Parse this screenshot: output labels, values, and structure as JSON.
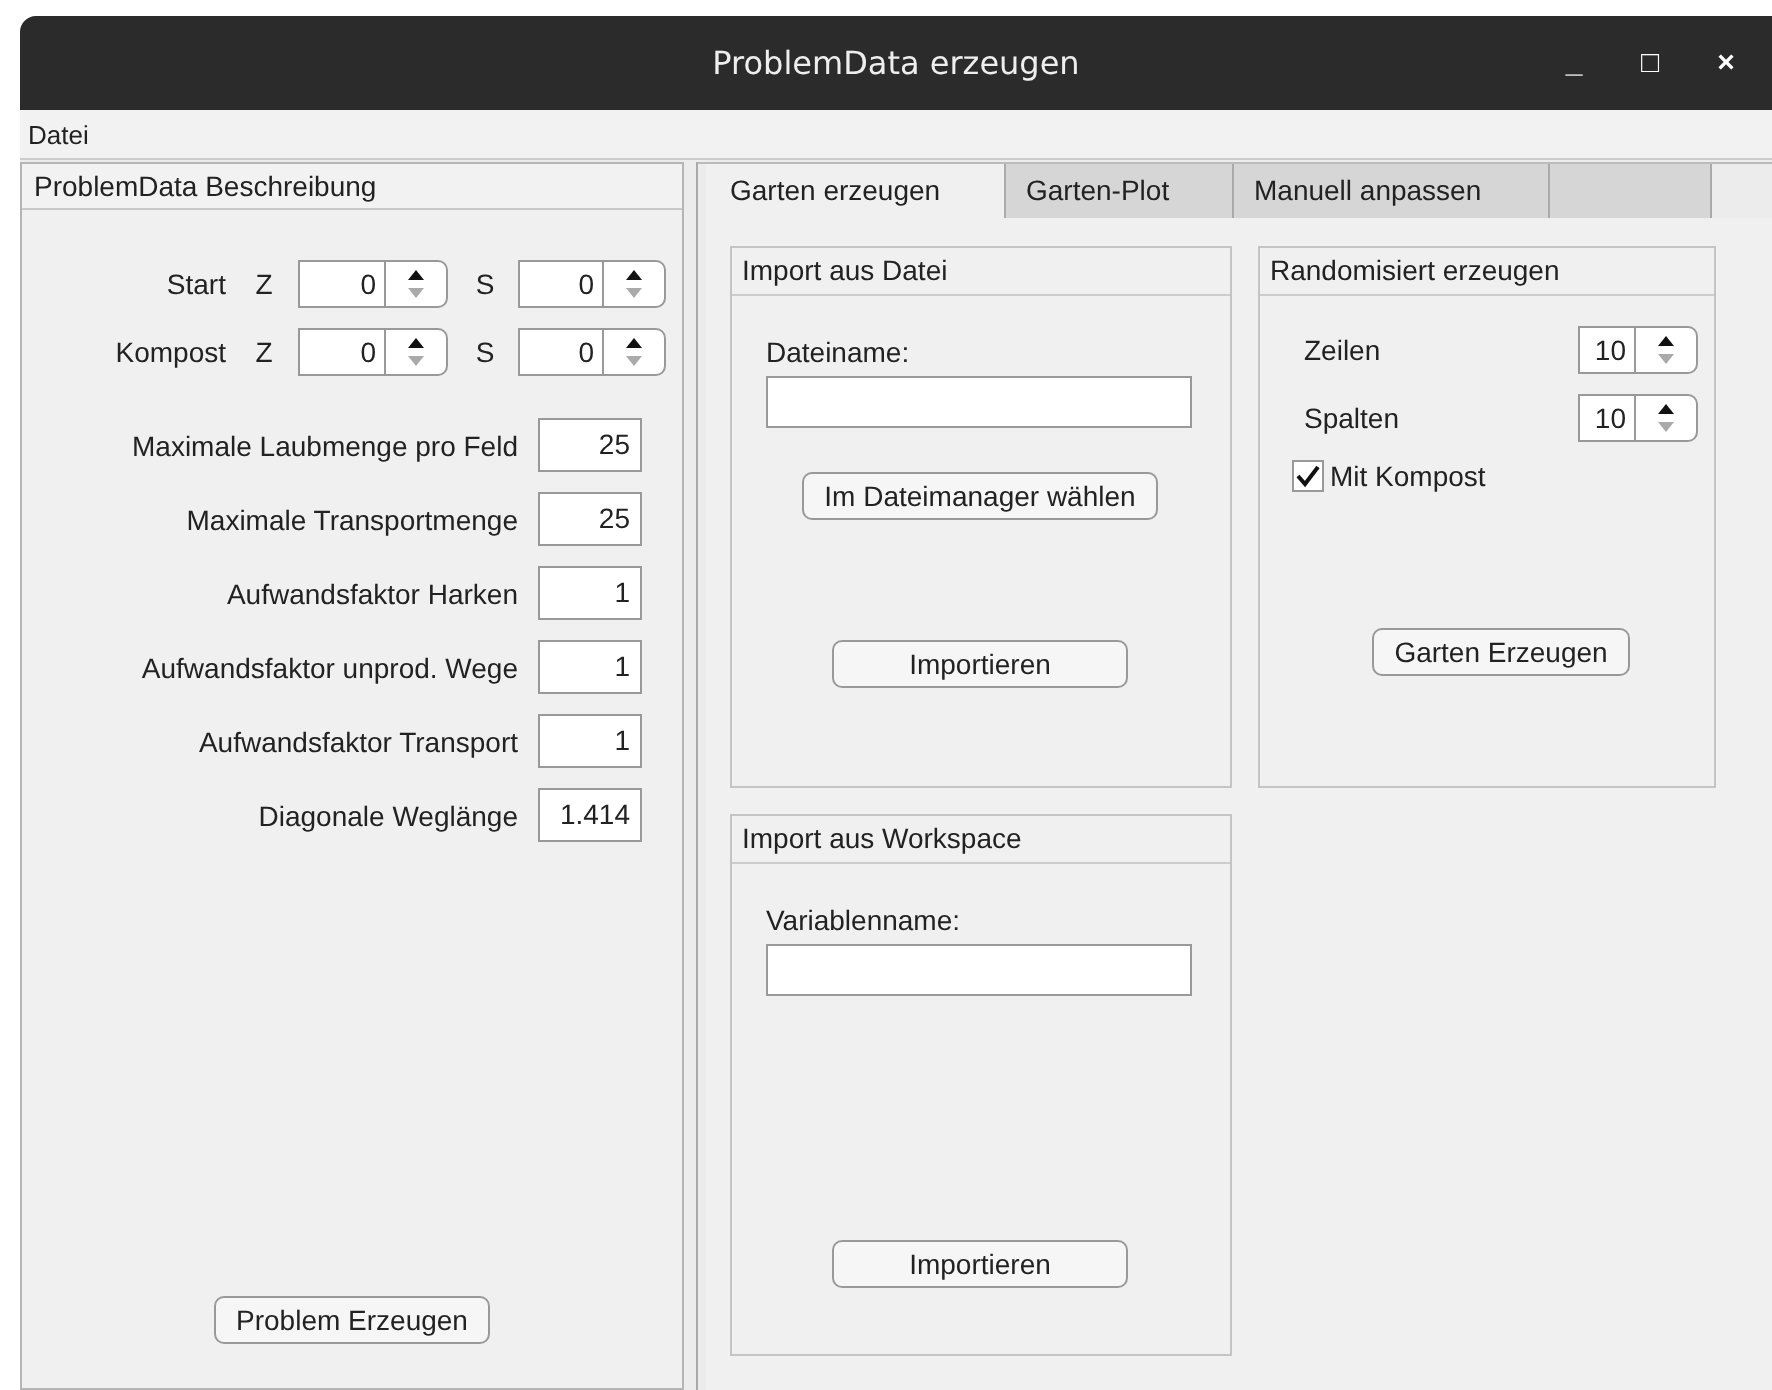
{
  "window": {
    "title": "ProblemData erzeugen",
    "controls": [
      "_",
      "□",
      "×"
    ]
  },
  "menu": [
    "Datei"
  ],
  "left_panel": {
    "title": "ProblemData Beschreibung",
    "coord_rows": [
      {
        "label": "Start",
        "z_label": "Z",
        "z_value": "0",
        "s_label": "S",
        "s_value": "0"
      },
      {
        "label": "Kompost",
        "z_label": "Z",
        "z_value": "0",
        "s_label": "S",
        "s_value": "0"
      }
    ],
    "fields": [
      {
        "label": "Maximale Laubmenge pro Feld",
        "value": "25"
      },
      {
        "label": "Maximale Transportmenge",
        "value": "25"
      },
      {
        "label": "Aufwandsfaktor Harken",
        "value": "1"
      },
      {
        "label": "Aufwandsfaktor unprod. Wege",
        "value": "1"
      },
      {
        "label": "Aufwandsfaktor Transport",
        "value": "1"
      },
      {
        "label": "Diagonale Weglänge",
        "value": "1.414"
      }
    ],
    "button": "Problem Erzeugen"
  },
  "tabs": [
    {
      "label": "Garten erzeugen",
      "selected": true
    },
    {
      "label": "Garten-Plot",
      "selected": false
    },
    {
      "label": "Manuell anpassen",
      "selected": false
    }
  ],
  "import_file": {
    "title": "Import aus Datei",
    "field_label": "Dateiname:",
    "browse_button": "Im Dateimanager wählen",
    "import_button": "Importieren"
  },
  "random": {
    "title": "Randomisiert erzeugen",
    "spinners": [
      {
        "label": "Zeilen",
        "value": "10"
      },
      {
        "label": "Spalten",
        "value": "10"
      }
    ],
    "checkbox": {
      "label": "Mit Kompost",
      "checked": true
    },
    "button": "Garten Erzeugen"
  },
  "import_workspace": {
    "title": "Import aus Workspace",
    "field_label": "Variablenname:",
    "import_button": "Importieren"
  }
}
